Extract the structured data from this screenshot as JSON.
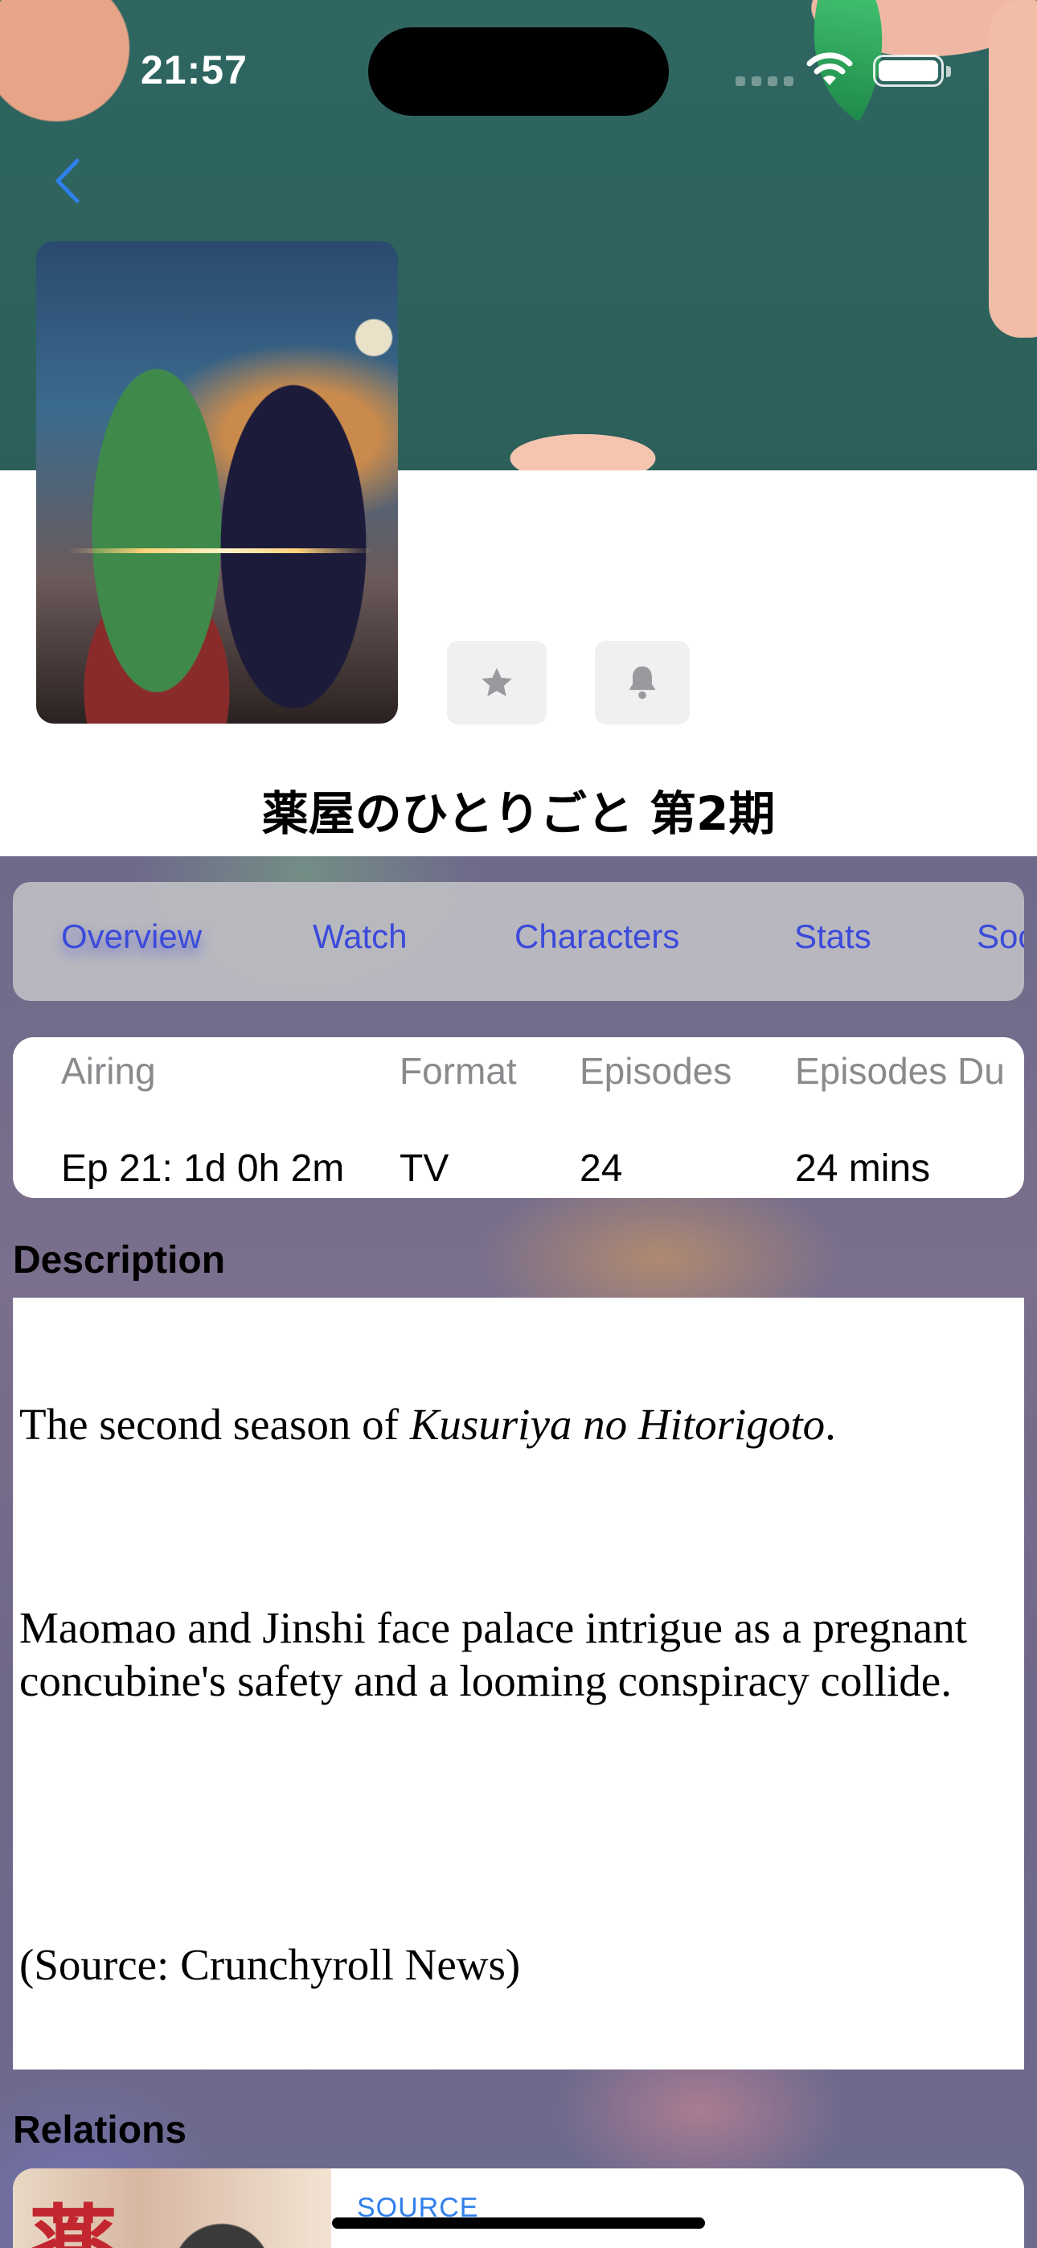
{
  "status_bar": {
    "time": "21:57"
  },
  "header": {
    "back_icon": "chevron-left-icon"
  },
  "actions": {
    "favorite_icon": "star-icon",
    "notify_icon": "bell-icon"
  },
  "anime": {
    "title": "薬屋のひとりごと 第2期"
  },
  "tabs": [
    {
      "label": "Overview",
      "active": true
    },
    {
      "label": "Watch",
      "active": false
    },
    {
      "label": "Characters",
      "active": false
    },
    {
      "label": "Stats",
      "active": false
    },
    {
      "label": "Soc",
      "active": false
    }
  ],
  "info": [
    {
      "label": "Airing",
      "value": "Ep 21: 1d 0h 2m"
    },
    {
      "label": "Format",
      "value": "TV"
    },
    {
      "label": "Episodes",
      "value": "24"
    },
    {
      "label": "Episodes Du",
      "value": "24 mins"
    }
  ],
  "description": {
    "heading": "Description",
    "p1_prefix": "The second season of ",
    "p1_italic": "Kusuriya no Hitorigoto",
    "p1_suffix": ".",
    "p2": "Maomao and Jinshi face palace intrigue as a pregnant concubine's safety and a looming conspiracy collide.",
    "p3": "(Source: Crunchyroll News)"
  },
  "relations": {
    "heading": "Relations",
    "items": [
      {
        "type": "SOURCE",
        "thumb_text": "薬"
      }
    ]
  },
  "colors": {
    "accent": "#3b4adb",
    "link": "#2f80ed",
    "tab_bar": "#bebec3"
  }
}
